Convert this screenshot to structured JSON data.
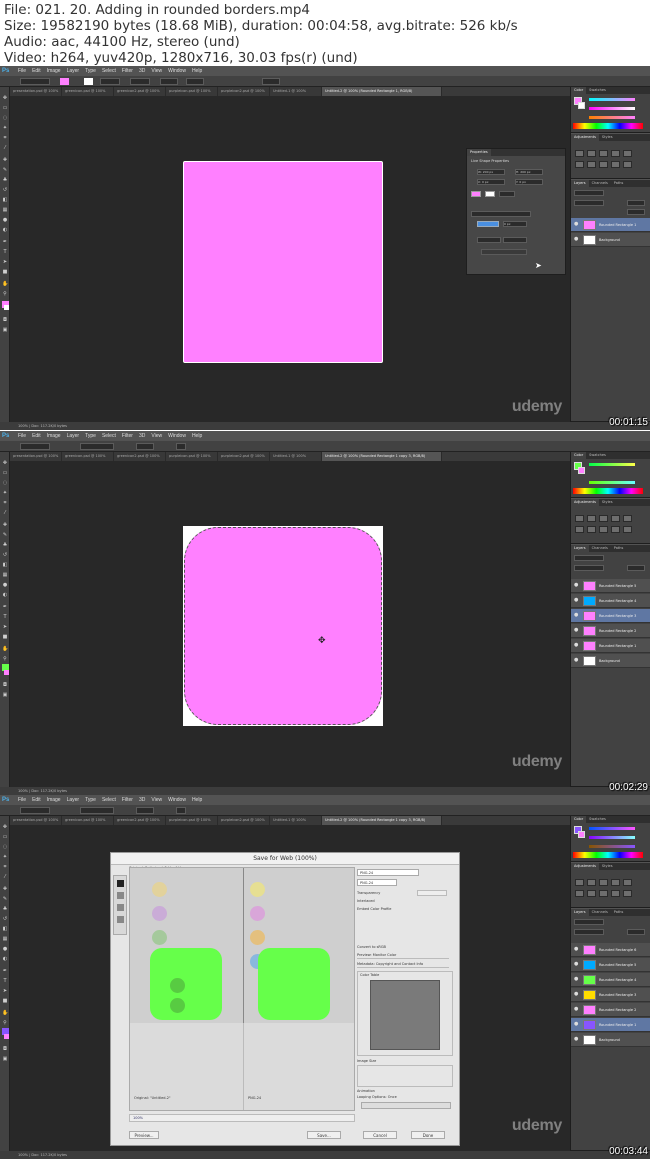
{
  "video_info": {
    "file": "File: 021. 20. Adding in rounded borders.mp4",
    "size": "Size: 19582190 bytes (18.68 MiB), duration: 00:04:58, avg.bitrate: 526 kb/s",
    "audio": "Audio: aac, 44100 Hz, stereo (und)",
    "video": "Video: h264, yuv420p, 1280x716, 30.03 fps(r) (und)"
  },
  "app": {
    "logo": "Ps",
    "menu": [
      "File",
      "Edit",
      "Image",
      "Layer",
      "Type",
      "Select",
      "Filter",
      "3D",
      "View",
      "Window",
      "Help"
    ]
  },
  "watermark": "udemy",
  "frames": [
    {
      "timestamp": "00:01:15",
      "tabs": [
        "presentation.psd @ 100%",
        "greenicon.psd @ 100%",
        "greenicon2.psd @ 100%",
        "purpleicon.psd @ 100%",
        "purpleicon2.psd @ 100%",
        "Untitled-1 @ 100%",
        "Untitled-2 @ 100% (Rounded Rectangle 1, RGB/8)"
      ],
      "active_tab": 6,
      "status": "100% | Doc: 117.2K/0 bytes",
      "properties": {
        "title": "Properties",
        "subtitle": "Live Shape Properties",
        "w": "W: 200 px",
        "h": "H: 200 px",
        "x": "X: 0 px",
        "y": "Y: 0 px",
        "corner": "0 px"
      },
      "layers": [
        {
          "name": "Rounded Rectangle 1",
          "color": "#ff80ff",
          "selected": true
        },
        {
          "name": "Background",
          "color": "#ffffff",
          "selected": false
        }
      ],
      "shape_color": "#ff80ff"
    },
    {
      "timestamp": "00:02:29",
      "tabs": [
        "presentation.psd @ 100%",
        "greenicon.psd @ 100%",
        "greenicon2.psd @ 100%",
        "purpleicon.psd @ 100%",
        "purpleicon2.psd @ 100%",
        "Untitled-1 @ 100%",
        "Untitled-2 @ 100% (Rounded Rectangle 1 copy 3, RGB/8)"
      ],
      "active_tab": 6,
      "status": "100% | Doc: 117.2K/0 bytes",
      "layers": [
        {
          "name": "Rounded Rectangle 5",
          "color": "#ff80ff",
          "selected": false
        },
        {
          "name": "Rounded Rectangle 4",
          "color": "#00aaff",
          "selected": false
        },
        {
          "name": "Rounded Rectangle 3",
          "color": "#ff80ff",
          "selected": true
        },
        {
          "name": "Rounded Rectangle 2",
          "color": "#ff80ff",
          "selected": false
        },
        {
          "name": "Rounded Rectangle 1",
          "color": "#ff80ff",
          "selected": false
        },
        {
          "name": "Background",
          "color": "#ffffff",
          "selected": false
        }
      ],
      "shape_color": "#ff80ff"
    },
    {
      "timestamp": "00:03:44",
      "tabs": [
        "presentation.psd @ 100%",
        "greenicon.psd @ 100%",
        "greenicon2.psd @ 100%",
        "purpleicon.psd @ 100%",
        "purpleicon2.psd @ 100%",
        "Untitled-1 @ 100%",
        "Untitled-2 @ 100% (Rounded Rectangle 1 copy 3, RGB/8)"
      ],
      "active_tab": 6,
      "status": "100% | Doc: 117.2K/0 bytes",
      "save_for_web": {
        "title": "Save for Web (100%)",
        "view_tabs": [
          "Original",
          "Optimized",
          "2-Up",
          "4-Up"
        ],
        "preset": "PNG-24",
        "transparency": "Transparency",
        "interlaced": "Interlaced",
        "embed": "Embed Color Profile",
        "convert": "Convert to sRGB",
        "preview": "Preview: Monitor Color",
        "metadata": "Metadata: Copyright and Contact Info",
        "color_table": "Color Table",
        "image_size": "Image Size",
        "animation": "Animation",
        "looping": "Looping Options: Once",
        "left_info": "Original: \"Untitled-2\"",
        "right_info": "PNG-24",
        "zoom": "100%",
        "buttons": [
          "Preview...",
          "Save...",
          "Cancel",
          "Done"
        ]
      },
      "layers": [
        {
          "name": "Rounded Rectangle 6",
          "color": "#ff80ff",
          "selected": false
        },
        {
          "name": "Rounded Rectangle 5",
          "color": "#00aaff",
          "selected": false
        },
        {
          "name": "Rounded Rectangle 4",
          "color": "#66ff4a",
          "selected": false
        },
        {
          "name": "Rounded Rectangle 3",
          "color": "#ffdd00",
          "selected": false
        },
        {
          "name": "Rounded Rectangle 2",
          "color": "#ff80ff",
          "selected": false
        },
        {
          "name": "Rounded Rectangle 1",
          "color": "#8855ff",
          "selected": true
        },
        {
          "name": "Background",
          "color": "#ffffff",
          "selected": false
        }
      ],
      "shape_color": "#66ff4a"
    }
  ]
}
